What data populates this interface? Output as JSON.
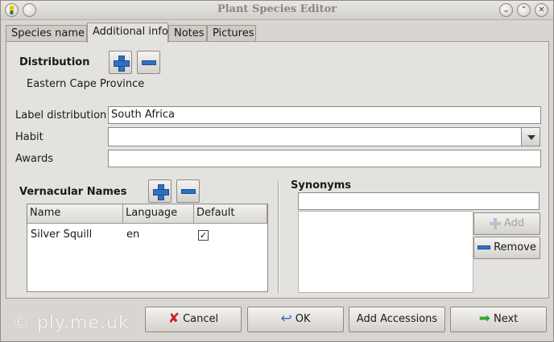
{
  "window": {
    "title": "Plant Species Editor"
  },
  "tabs": [
    {
      "label": "Species name"
    },
    {
      "label": "Additional info"
    },
    {
      "label": "Notes"
    },
    {
      "label": "Pictures"
    }
  ],
  "distribution": {
    "label": "Distribution",
    "items": [
      "Eastern Cape Province"
    ]
  },
  "fields": {
    "label_distribution": {
      "label": "Label distribution",
      "value": "South Africa"
    },
    "habit": {
      "label": "Habit",
      "value": ""
    },
    "awards": {
      "label": "Awards",
      "value": ""
    }
  },
  "vernacular": {
    "label": "Vernacular Names",
    "columns": [
      "Name",
      "Language",
      "Default"
    ],
    "rows": [
      {
        "name": "Silver Squill",
        "language": "en",
        "default": "✓"
      }
    ]
  },
  "synonyms": {
    "label": "Synonyms",
    "entry_value": "",
    "add_label": "Add",
    "remove_label": "Remove"
  },
  "buttons": {
    "cancel": "Cancel",
    "ok": "OK",
    "add_accessions": "Add Accessions",
    "next": "Next"
  },
  "watermark": "© ply.me.uk",
  "icons": {
    "app": "plant-app-icon",
    "minimize": "minimize-icon",
    "maximize": "maximize-icon",
    "close": "close-icon"
  }
}
